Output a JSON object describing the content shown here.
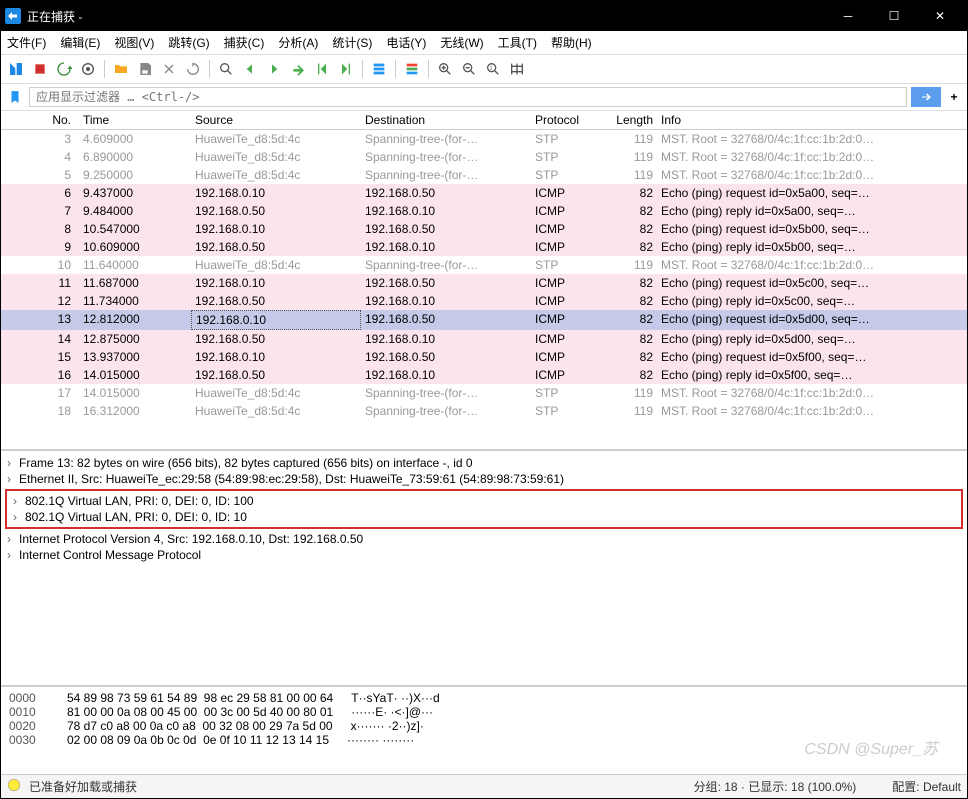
{
  "window": {
    "title": "正在捕获 -"
  },
  "menu": [
    "文件(F)",
    "编辑(E)",
    "视图(V)",
    "跳转(G)",
    "捕获(C)",
    "分析(A)",
    "统计(S)",
    "电话(Y)",
    "无线(W)",
    "工具(T)",
    "帮助(H)"
  ],
  "filter": {
    "placeholder": "应用显示过滤器 … <Ctrl-/>"
  },
  "columns": {
    "no": "No.",
    "time": "Time",
    "src": "Source",
    "dst": "Destination",
    "proto": "Protocol",
    "len": "Length",
    "info": "Info"
  },
  "packets": [
    {
      "no": "3",
      "time": "4.609000",
      "src": "HuaweiTe_d8:5d:4c",
      "dst": "Spanning-tree-(for-…",
      "proto": "STP",
      "len": "119",
      "info": "MST. Root = 32768/0/4c:1f:cc:1b:2d:0…",
      "cls": "row-gray"
    },
    {
      "no": "4",
      "time": "6.890000",
      "src": "HuaweiTe_d8:5d:4c",
      "dst": "Spanning-tree-(for-…",
      "proto": "STP",
      "len": "119",
      "info": "MST. Root = 32768/0/4c:1f:cc:1b:2d:0…",
      "cls": "row-gray"
    },
    {
      "no": "5",
      "time": "9.250000",
      "src": "HuaweiTe_d8:5d:4c",
      "dst": "Spanning-tree-(for-…",
      "proto": "STP",
      "len": "119",
      "info": "MST. Root = 32768/0/4c:1f:cc:1b:2d:0…",
      "cls": "row-gray"
    },
    {
      "no": "6",
      "time": "9.437000",
      "src": "192.168.0.10",
      "dst": "192.168.0.50",
      "proto": "ICMP",
      "len": "82",
      "info": "Echo (ping) request  id=0x5a00, seq=…",
      "cls": "row-pink"
    },
    {
      "no": "7",
      "time": "9.484000",
      "src": "192.168.0.50",
      "dst": "192.168.0.10",
      "proto": "ICMP",
      "len": "82",
      "info": "Echo (ping) reply    id=0x5a00, seq=…",
      "cls": "row-pink"
    },
    {
      "no": "8",
      "time": "10.547000",
      "src": "192.168.0.10",
      "dst": "192.168.0.50",
      "proto": "ICMP",
      "len": "82",
      "info": "Echo (ping) request  id=0x5b00, seq=…",
      "cls": "row-pink"
    },
    {
      "no": "9",
      "time": "10.609000",
      "src": "192.168.0.50",
      "dst": "192.168.0.10",
      "proto": "ICMP",
      "len": "82",
      "info": "Echo (ping) reply    id=0x5b00, seq=…",
      "cls": "row-pink"
    },
    {
      "no": "10",
      "time": "11.640000",
      "src": "HuaweiTe_d8:5d:4c",
      "dst": "Spanning-tree-(for-…",
      "proto": "STP",
      "len": "119",
      "info": "MST. Root = 32768/0/4c:1f:cc:1b:2d:0…",
      "cls": "row-gray"
    },
    {
      "no": "11",
      "time": "11.687000",
      "src": "192.168.0.10",
      "dst": "192.168.0.50",
      "proto": "ICMP",
      "len": "82",
      "info": "Echo (ping) request  id=0x5c00, seq=…",
      "cls": "row-pink"
    },
    {
      "no": "12",
      "time": "11.734000",
      "src": "192.168.0.50",
      "dst": "192.168.0.10",
      "proto": "ICMP",
      "len": "82",
      "info": "Echo (ping) reply    id=0x5c00, seq=…",
      "cls": "row-pink"
    },
    {
      "no": "13",
      "time": "12.812000",
      "src": "192.168.0.10",
      "dst": "192.168.0.50",
      "proto": "ICMP",
      "len": "82",
      "info": "Echo (ping) request  id=0x5d00, seq=…",
      "cls": "row-pink row-sel"
    },
    {
      "no": "14",
      "time": "12.875000",
      "src": "192.168.0.50",
      "dst": "192.168.0.10",
      "proto": "ICMP",
      "len": "82",
      "info": "Echo (ping) reply    id=0x5d00, seq=…",
      "cls": "row-pink"
    },
    {
      "no": "15",
      "time": "13.937000",
      "src": "192.168.0.10",
      "dst": "192.168.0.50",
      "proto": "ICMP",
      "len": "82",
      "info": "Echo (ping) request  id=0x5f00, seq=…",
      "cls": "row-pink"
    },
    {
      "no": "16",
      "time": "14.015000",
      "src": "192.168.0.50",
      "dst": "192.168.0.10",
      "proto": "ICMP",
      "len": "82",
      "info": "Echo (ping) reply    id=0x5f00, seq=…",
      "cls": "row-pink"
    },
    {
      "no": "17",
      "time": "14.015000",
      "src": "HuaweiTe_d8:5d:4c",
      "dst": "Spanning-tree-(for-…",
      "proto": "STP",
      "len": "119",
      "info": "MST. Root = 32768/0/4c:1f:cc:1b:2d:0…",
      "cls": "row-gray"
    },
    {
      "no": "18",
      "time": "16.312000",
      "src": "HuaweiTe_d8:5d:4c",
      "dst": "Spanning-tree-(for-…",
      "proto": "STP",
      "len": "119",
      "info": "MST. Root = 32768/0/4c:1f:cc:1b:2d:0…",
      "cls": "row-gray"
    }
  ],
  "tree": {
    "frame": "Frame 13: 82 bytes on wire (656 bits), 82 bytes captured (656 bits) on interface -, id 0",
    "eth": "Ethernet II, Src: HuaweiTe_ec:29:58 (54:89:98:ec:29:58), Dst: HuaweiTe_73:59:61 (54:89:98:73:59:61)",
    "vlan1": "802.1Q Virtual LAN, PRI: 0, DEI: 0, ID: 100",
    "vlan2": "802.1Q Virtual LAN, PRI: 0, DEI: 0, ID: 10",
    "ip": "Internet Protocol Version 4, Src: 192.168.0.10, Dst: 192.168.0.50",
    "icmp": "Internet Control Message Protocol"
  },
  "hex": [
    {
      "off": "0000",
      "b": "54 89 98 73 59 61 54 89  98 ec 29 58 81 00 00 64",
      "a": "T··sYaT· ··)X···d"
    },
    {
      "off": "0010",
      "b": "81 00 00 0a 08 00 45 00  00 3c 00 5d 40 00 80 01",
      "a": "······E· ·<·]@···"
    },
    {
      "off": "0020",
      "b": "78 d7 c0 a8 00 0a c0 a8  00 32 08 00 29 7a 5d 00",
      "a": "x······· ·2··)z]·"
    },
    {
      "off": "0030",
      "b": "02 00 08 09 0a 0b 0c 0d  0e 0f 10 11 12 13 14 15",
      "a": "········ ········"
    }
  ],
  "status": {
    "left": "已准备好加载或捕获",
    "mid": "分组: 18 · 已显示: 18 (100.0%)",
    "right": "配置: Default"
  },
  "watermark": "CSDN @Super_苏"
}
